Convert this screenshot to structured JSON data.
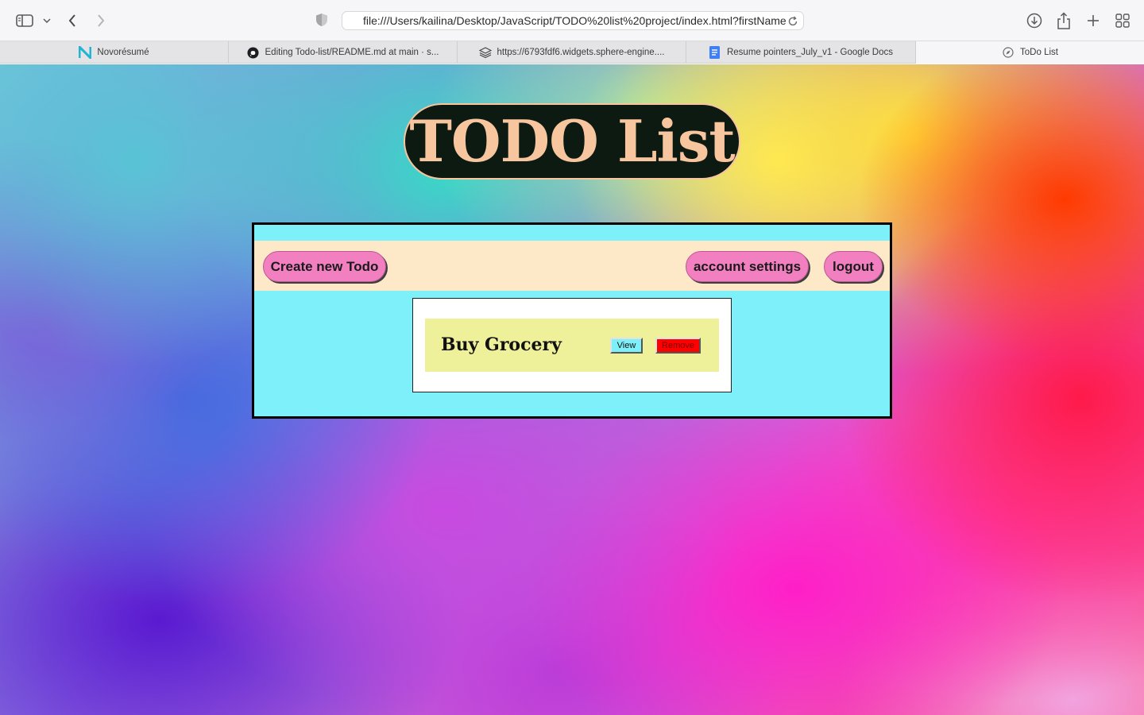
{
  "browser": {
    "address_url": "file:///Users/kailina/Desktop/JavaScript/TODO%20list%20project/index.html?firstName",
    "tabs": [
      {
        "label": "Novorésumé",
        "icon": "novoresume-icon"
      },
      {
        "label": "Editing Todo-list/README.md at main · s...",
        "icon": "github-icon"
      },
      {
        "label": "https://6793fdf6.widgets.sphere-engine....",
        "icon": "layers-icon"
      },
      {
        "label": "Resume pointers_July_v1 - Google Docs",
        "icon": "google-docs-icon"
      },
      {
        "label": "ToDo List",
        "icon": "compass-icon",
        "active": true
      }
    ]
  },
  "app": {
    "title": "TODO List",
    "nav": {
      "create_label": "Create new Todo",
      "account_label": "account settings",
      "logout_label": "logout"
    },
    "todos": [
      {
        "title": "Buy Grocery",
        "view_label": "View",
        "remove_label": "Remove"
      }
    ]
  },
  "colors": {
    "title_bg": "#0c1a12",
    "title_text": "#f7c59e",
    "main_bg": "#7ef0f9",
    "nav_bg": "#fde9c8",
    "pill_btn": "#f27fc0",
    "todo_bg": "#eff09a",
    "remove_btn": "#ff0000"
  }
}
